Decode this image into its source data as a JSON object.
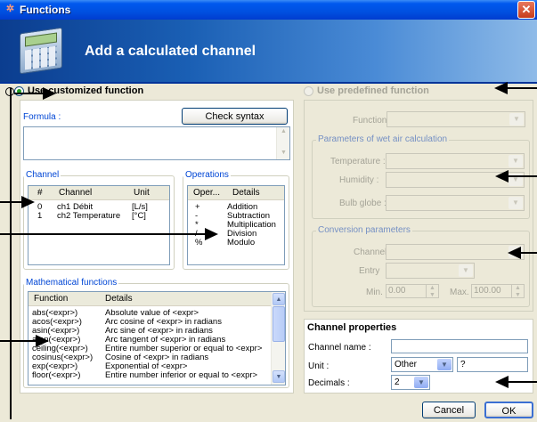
{
  "window": {
    "title": "Functions",
    "close_symbol": "✕",
    "app_icon_symbol": "✲"
  },
  "banner": {
    "title": "Add a calculated channel"
  },
  "options": {
    "customized_label": "Use customized function",
    "predefined_label": "Use predefined function"
  },
  "formula": {
    "label": "Formula :",
    "value": "",
    "check_syntax_label": "Check syntax"
  },
  "channel_group": {
    "label": "Channel",
    "headers": [
      "#",
      "Channel",
      "Unit"
    ],
    "rows": [
      {
        "num": "0",
        "name": "ch1 Débit",
        "unit": "[L/s]"
      },
      {
        "num": "1",
        "name": "ch2 Temperature",
        "unit": "[°C]"
      }
    ]
  },
  "operations_group": {
    "label": "Operations",
    "headers": [
      "Oper...",
      "Details"
    ],
    "rows": [
      {
        "op": "+",
        "detail": "Addition"
      },
      {
        "op": "-",
        "detail": "Subtraction"
      },
      {
        "op": "*",
        "detail": "Multiplication"
      },
      {
        "op": "/",
        "detail": "Division"
      },
      {
        "op": "%",
        "detail": "Modulo"
      }
    ]
  },
  "math_group": {
    "label": "Mathematical functions",
    "headers": [
      "Function",
      "Details"
    ],
    "rows": [
      {
        "fn": "abs(<expr>)",
        "detail": "Absolute value of <expr>"
      },
      {
        "fn": "acos(<expr>)",
        "detail": "Arc cosine of <expr> in radians"
      },
      {
        "fn": "asin(<expr>)",
        "detail": "Arc sine of <expr> in radians"
      },
      {
        "fn": "atan(<expr>)",
        "detail": "Arc tangent of <expr> in radians"
      },
      {
        "fn": "ceiling(<expr>)",
        "detail": "Entire number superior or equal to <expr>"
      },
      {
        "fn": "cosinus(<expr>)",
        "detail": "Cosine of <expr> in radians"
      },
      {
        "fn": "exp(<expr>)",
        "detail": "Exponential of <expr>"
      },
      {
        "fn": "floor(<expr>)",
        "detail": "Entire number inferior or equal to <expr>"
      }
    ]
  },
  "predefined": {
    "function_label": "Function :",
    "wet_air_label": "Parameters of wet air calculation",
    "temperature_label": "Temperature :",
    "humidity_label": "Humidity :",
    "bulb_label": "Bulb globe :",
    "conversion_label": "Conversion parameters",
    "channel_label": "Channel",
    "entry_label": "Entry",
    "min_label": "Min.",
    "min_value": "0.00",
    "max_label": "Max.",
    "max_value": "100.00"
  },
  "channel_props": {
    "title": "Channel properties",
    "name_label": "Channel name :",
    "name_value": "",
    "unit_label": "Unit :",
    "unit_value": "Other",
    "unit_custom_value": "?",
    "decimals_label": "Decimals :",
    "decimals_value": "2"
  },
  "footer": {
    "cancel_label": "Cancel",
    "ok_label": "OK"
  }
}
